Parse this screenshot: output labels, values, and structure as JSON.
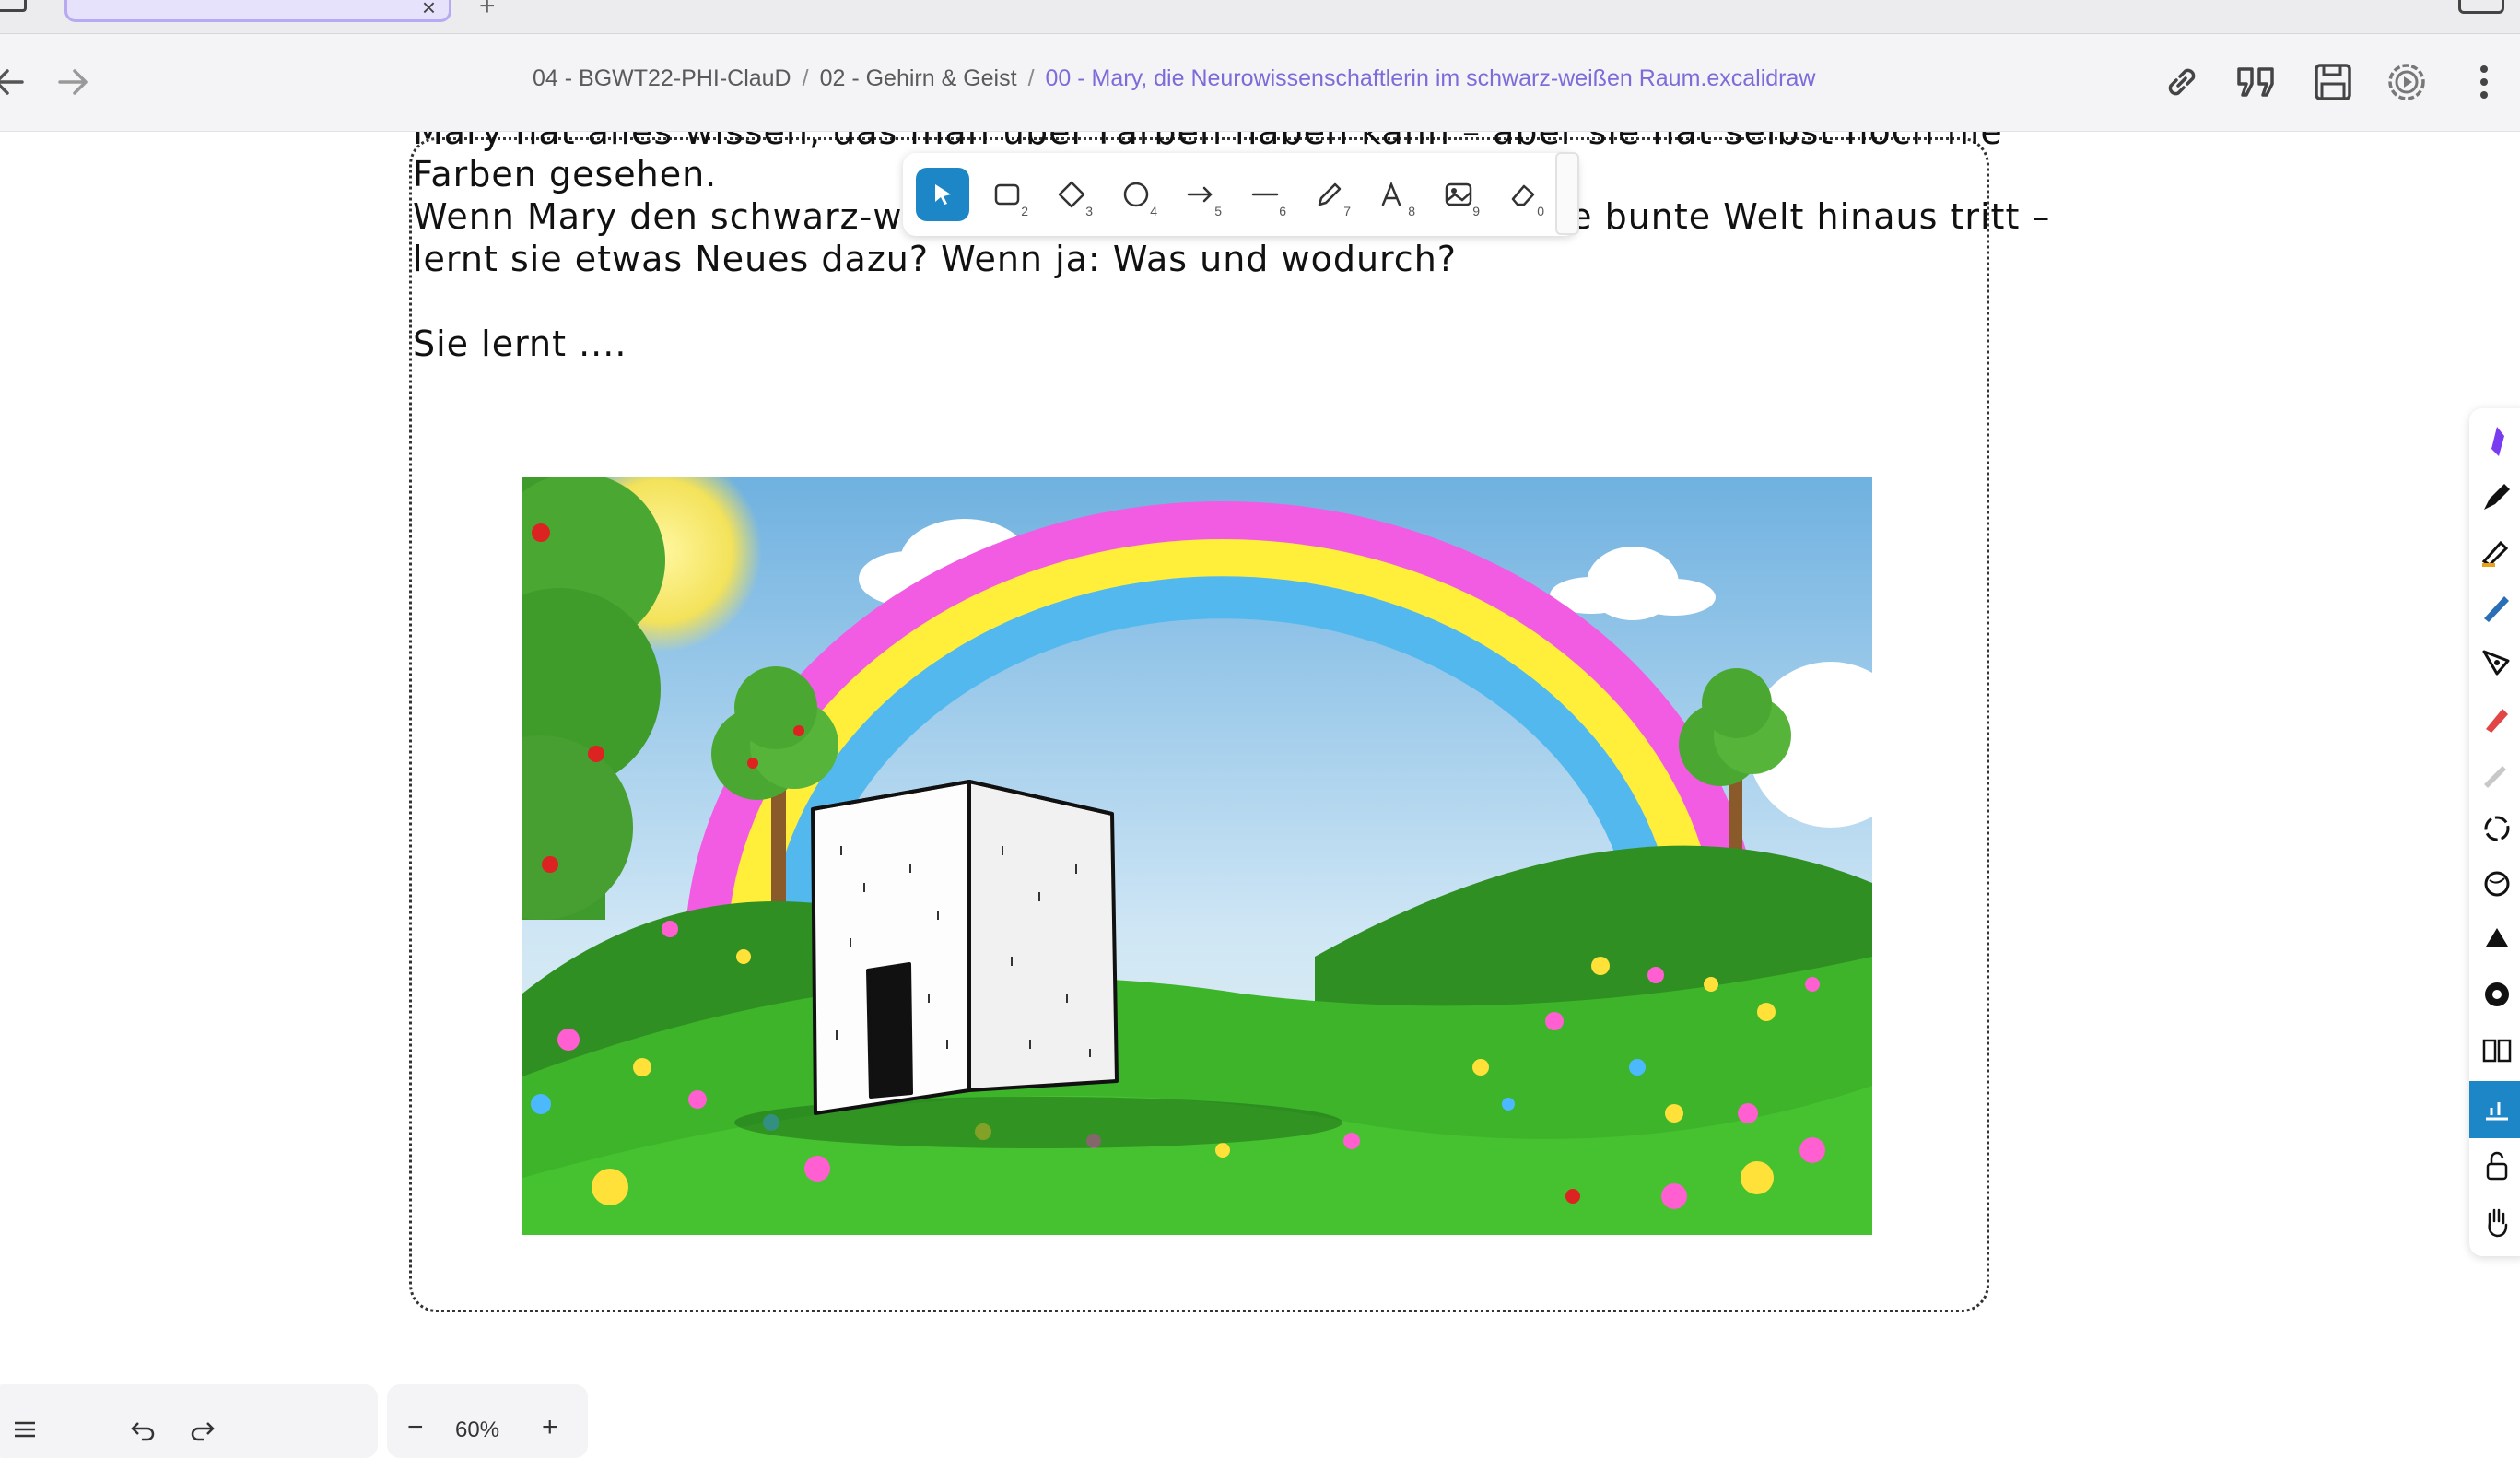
{
  "tabs": {
    "plus_label": "+",
    "close_label": "×"
  },
  "breadcrumb": {
    "part1": "04 - BGWT22-PHI-ClauD",
    "separator": "/",
    "part2": "02 - Gehirn & Geist",
    "current": "00 - Mary, die Neurowissenschaftlerin im schwarz-weißen Raum.excalidraw"
  },
  "canvas": {
    "line_1": "Mary hat alles wissen, das man über Farben haben kann – aber sie hat selbst noch nie",
    "line_2": "Farben gesehen.",
    "line_3": "Wenn Mary den schwarz-weißen Raum unten verlässt und in die bunte Welt hinaus tritt –",
    "line_4": "lernt sie etwas Neues dazu? Wenn ja: Was und wodurch?",
    "line_5": "Sie lernt ....",
    "image_label": "Bild: Weißer Raum unter einem Regenbogen"
  },
  "toolbar": {
    "tools": [
      {
        "name": "selection",
        "key": "1"
      },
      {
        "name": "rectangle",
        "key": "2"
      },
      {
        "name": "diamond",
        "key": "3"
      },
      {
        "name": "ellipse",
        "key": "4"
      },
      {
        "name": "arrow",
        "key": "5"
      },
      {
        "name": "line",
        "key": "6"
      },
      {
        "name": "draw",
        "key": "7"
      },
      {
        "name": "text",
        "key": "8"
      },
      {
        "name": "image",
        "key": "9"
      },
      {
        "name": "eraser",
        "key": "0"
      }
    ]
  },
  "footer": {
    "zoom": "60%",
    "zoom_out": "−",
    "zoom_in": "+"
  },
  "colors": {
    "accent": "#1d86c7",
    "breadcrumb_current": "#7b6cd9",
    "tab_active_border": "#b7a9f2"
  }
}
